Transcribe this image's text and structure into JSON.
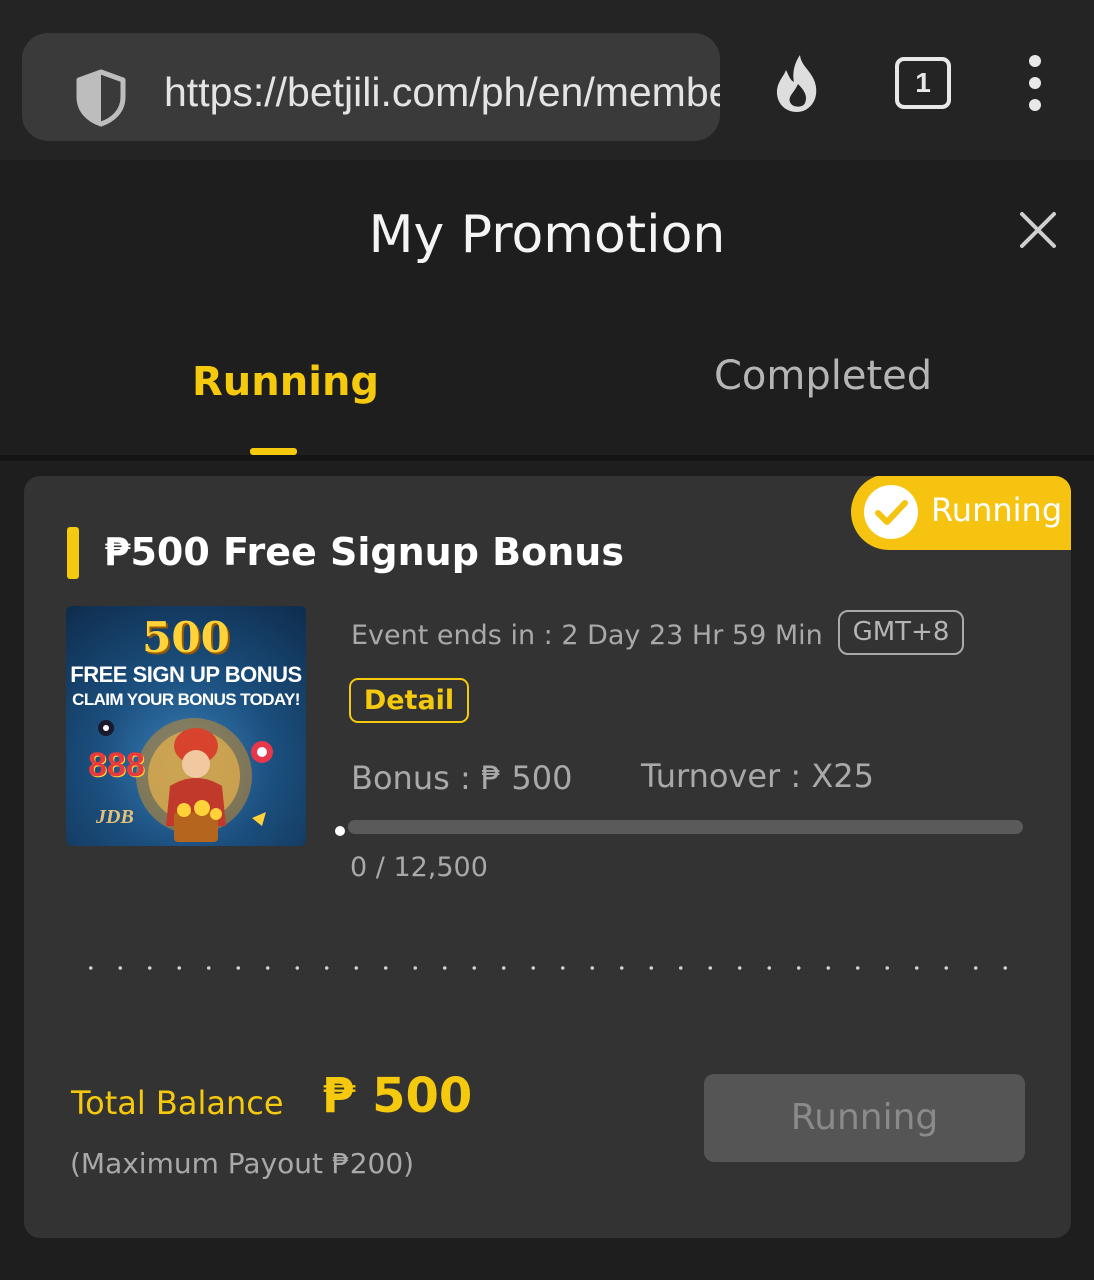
{
  "browser": {
    "url": "https://betjili.com/ph/en/member/promotion",
    "tab_count": "1"
  },
  "header": {
    "title": "My Promotion"
  },
  "tabs": [
    {
      "label": "Running",
      "active": true
    },
    {
      "label": "Completed",
      "active": false
    }
  ],
  "promotion": {
    "status": "Running",
    "title": "₱500 Free Signup Bonus",
    "banner": {
      "amount": "500",
      "line1": "FREE SIGN UP BONUS",
      "line2": "CLAIM YOUR BONUS TODAY!",
      "tag": "888",
      "brand": "JDB"
    },
    "event_ends": "Event ends in : 2 Day 23 Hr 59 Min",
    "timezone": "GMT+8",
    "detail_label": "Detail",
    "bonus": "Bonus : ₱ 500",
    "turnover": "Turnover : X25",
    "progress": {
      "current": 0,
      "target": 12500,
      "text": "0 / 12,500"
    },
    "total_balance_label": "Total Balance",
    "total_balance_value": "₱ 500",
    "max_payout": "(Maximum Payout ₱200)",
    "action_label": "Running"
  },
  "colors": {
    "accent": "#f5c90d",
    "background": "#1e1e1e",
    "card": "#333333"
  }
}
